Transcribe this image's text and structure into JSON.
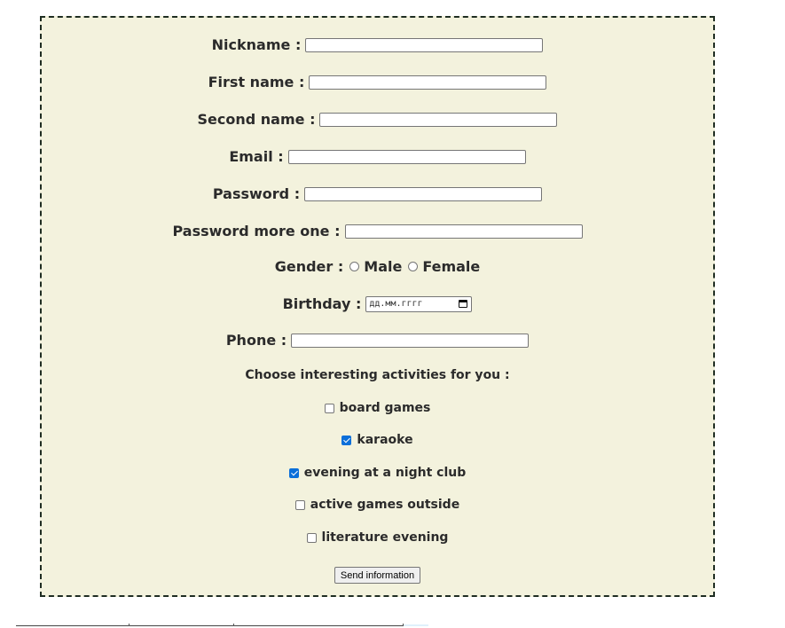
{
  "form": {
    "nickname_label": "Nickname :",
    "first_name_label": "First name :",
    "second_name_label": "Second name :",
    "email_label": "Email :",
    "password_label": "Password :",
    "password_repeat_label": "Password more one :",
    "gender_label": "Gender :",
    "gender_options": [
      "Male",
      "Female"
    ],
    "birthday_label": "Birthday :",
    "birthday_placeholder": "дд.мм.гггг",
    "phone_label": "Phone :",
    "activities_title": "Choose interesting activities for you :",
    "activities": [
      {
        "label": "board games",
        "checked": false
      },
      {
        "label": "karaoke",
        "checked": true
      },
      {
        "label": "evening at a night club",
        "checked": true
      },
      {
        "label": "active games outside",
        "checked": false
      },
      {
        "label": "literature evening",
        "checked": false
      }
    ],
    "submit_label": "Send information"
  },
  "colors": {
    "form_background": "#f3f2dd",
    "form_border": "#1f2d22",
    "checkbox_checked": "#0b6fd9"
  }
}
